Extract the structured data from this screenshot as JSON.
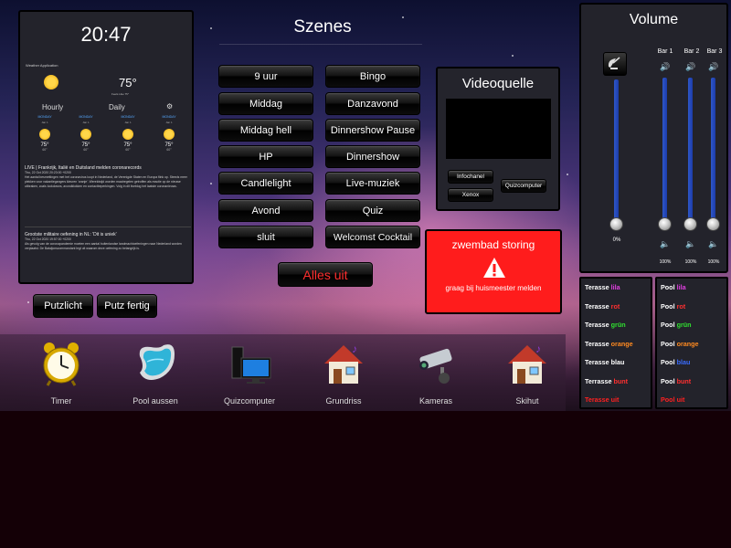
{
  "weather": {
    "time": "20:47",
    "app_name": "Weather Application",
    "current_temp": "75°",
    "current_sub": "Feels Like 75°",
    "tab_hourly": "Hourly",
    "tab_daily": "Daily",
    "forecast": [
      {
        "day": "MONDAY",
        "date": "Jan 1",
        "t1": "75°",
        "t2": "60°"
      },
      {
        "day": "MONDAY",
        "date": "Jan 1",
        "t1": "75°",
        "t2": "60°"
      },
      {
        "day": "MONDAY",
        "date": "Jan 1",
        "t1": "75°",
        "t2": "60°"
      },
      {
        "day": "MONDAY",
        "date": "Jan 1",
        "t1": "75°",
        "t2": "60°"
      }
    ],
    "news": [
      {
        "headline": "LIVE | Frankrijk, Italië en Duitsland melden coronarecords",
        "date": "Thu, 22 Oct 2020 20:23:00 +0200",
        "body": "Het aantal besmettingen met het coronavirus loopt in Nederland, de Verenigde Staten en Europa flink op. Steeds meer plekken voor vakantiegangers kleuren 'oranje'. Wereldwijd worden maatregelen getroffen als reactie op de nieuwe uitbraken, zoals lockdowns, avondklokken en contactbeperkingen. Volg in dit liveblog het laatste coronanieuws."
      },
      {
        "headline": "Grootste militaire oefening in NL: 'Dit is uniek'",
        "date": "Thu, 22 Oct 2020 19:57:00 +0200",
        "body": "Als gevolg van de coronapandemie moeten een aantal buitenlandse landmachtoefeningen naar Nederland worden verplaatst. De Bataljonscommandant legt uit waarom deze oefening zo belangrijk is."
      }
    ]
  },
  "szenes": {
    "title": "Szenes",
    "left": [
      "9 uur",
      "Middag",
      "Middag hell",
      "HP",
      "Candlelight",
      "Avond",
      "sluit"
    ],
    "right": [
      "Bingo",
      "Danzavond",
      "Dinnershow Pause",
      "Dinnershow",
      "Live-muziek",
      "Quiz",
      "Welcomst Cocktail"
    ],
    "all_off": "Alles uit"
  },
  "video": {
    "title": "Videoquelle",
    "buttons": {
      "infochanel": "Infochanel",
      "xenox": "Xenox",
      "quizcomputer": "Quizcomputer"
    }
  },
  "warning": {
    "title": "zwembad storing",
    "message": "graag bij huismeester melden",
    "color": "#ff1c1c"
  },
  "volume": {
    "title": "Volume",
    "labels": [
      "Bar 1",
      "Bar 2",
      "Bar 3"
    ],
    "main_level": "0%",
    "bar_levels": [
      "100%",
      "100%",
      "100%"
    ]
  },
  "putz": {
    "light": "Putzlicht",
    "done": "Putz fertig"
  },
  "terrace": [
    {
      "prefix": "Terasse",
      "word": "lila",
      "color": "#e040e0"
    },
    {
      "prefix": "Terasse",
      "word": "rot",
      "color": "#ff3030"
    },
    {
      "prefix": "Terasse",
      "word": "grün",
      "color": "#30e030"
    },
    {
      "prefix": "Terasse",
      "word": "orange",
      "color": "#ff8a20"
    },
    {
      "prefix": "Terasse",
      "word": "blau",
      "color": "#ffffff"
    },
    {
      "prefix": "Terrasse",
      "word": "bunt",
      "color": "#ff3030"
    },
    {
      "prefix": "Terasse",
      "word": "uit",
      "color": "#ff2020",
      "all_red": true
    }
  ],
  "pool": [
    {
      "prefix": "Pool",
      "word": "lila",
      "color": "#e040e0"
    },
    {
      "prefix": "Pool",
      "word": "rot",
      "color": "#ff3030"
    },
    {
      "prefix": "Pool",
      "word": "grün",
      "color": "#30e030"
    },
    {
      "prefix": "Pool",
      "word": "orange",
      "color": "#ff8a20"
    },
    {
      "prefix": "Pool",
      "word": "blau",
      "color": "#3a6cff"
    },
    {
      "prefix": "Pool",
      "word": "bunt",
      "color": "#ff3030"
    },
    {
      "prefix": "Pool",
      "word": "uit",
      "color": "#ff2020",
      "all_red": true
    }
  ],
  "dock": [
    {
      "label": "Timer",
      "icon": "alarm-clock-icon"
    },
    {
      "label": "Pool aussen",
      "icon": "pool-icon"
    },
    {
      "label": "Quizcomputer",
      "icon": "computer-icon"
    },
    {
      "label": "Grundriss",
      "icon": "house-icon"
    },
    {
      "label": "Kameras",
      "icon": "camera-icon"
    },
    {
      "label": "Skihut",
      "icon": "house-icon"
    }
  ]
}
